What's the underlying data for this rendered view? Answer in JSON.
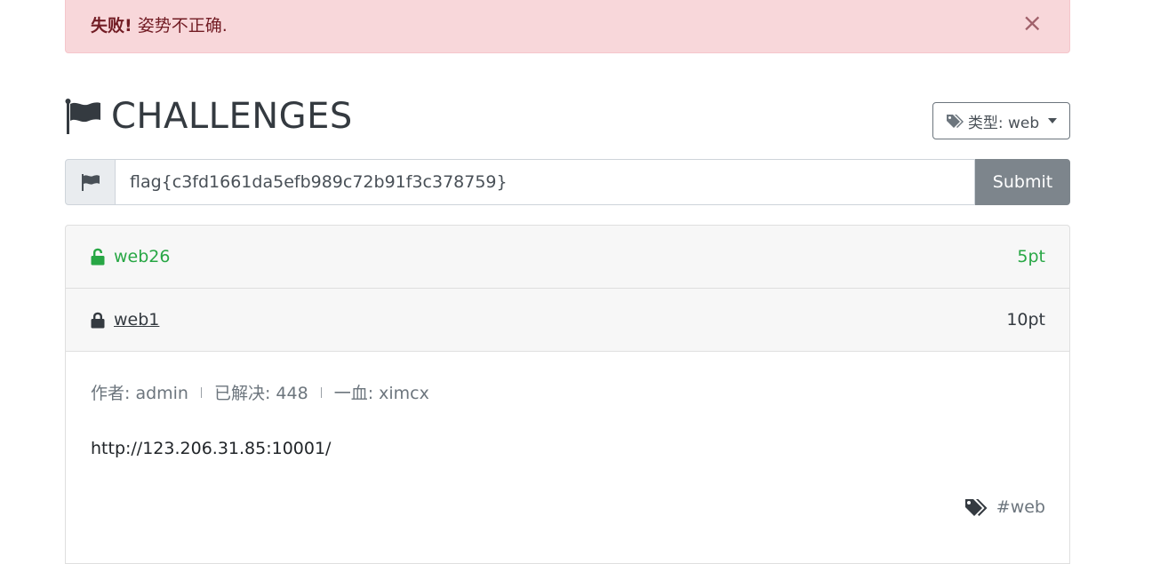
{
  "alert": {
    "strong": "失败!",
    "message": " 姿势不正确.",
    "close": "×"
  },
  "page": {
    "title": "CHALLENGES",
    "type_filter": "类型: web"
  },
  "flag_form": {
    "value": "flag{c3fd1661da5efb989c72b91f3c378759}",
    "submit_label": "Submit"
  },
  "challenges": [
    {
      "name": "web26",
      "points": "5pt",
      "status": "solved",
      "icon": "unlock-icon"
    },
    {
      "name": "web1",
      "points": "10pt",
      "status": "locked",
      "icon": "lock-icon"
    }
  ],
  "detail": {
    "author": "作者: admin",
    "solved": "已解决: 448",
    "first_blood": "一血: ximcx",
    "url": "http://123.206.31.85:10001/",
    "tag": "#web"
  },
  "colors": {
    "alert_bg": "#f8d7da",
    "alert_text": "#721c24",
    "solved_green": "#28a745",
    "submit_gray": "#7d858c"
  }
}
